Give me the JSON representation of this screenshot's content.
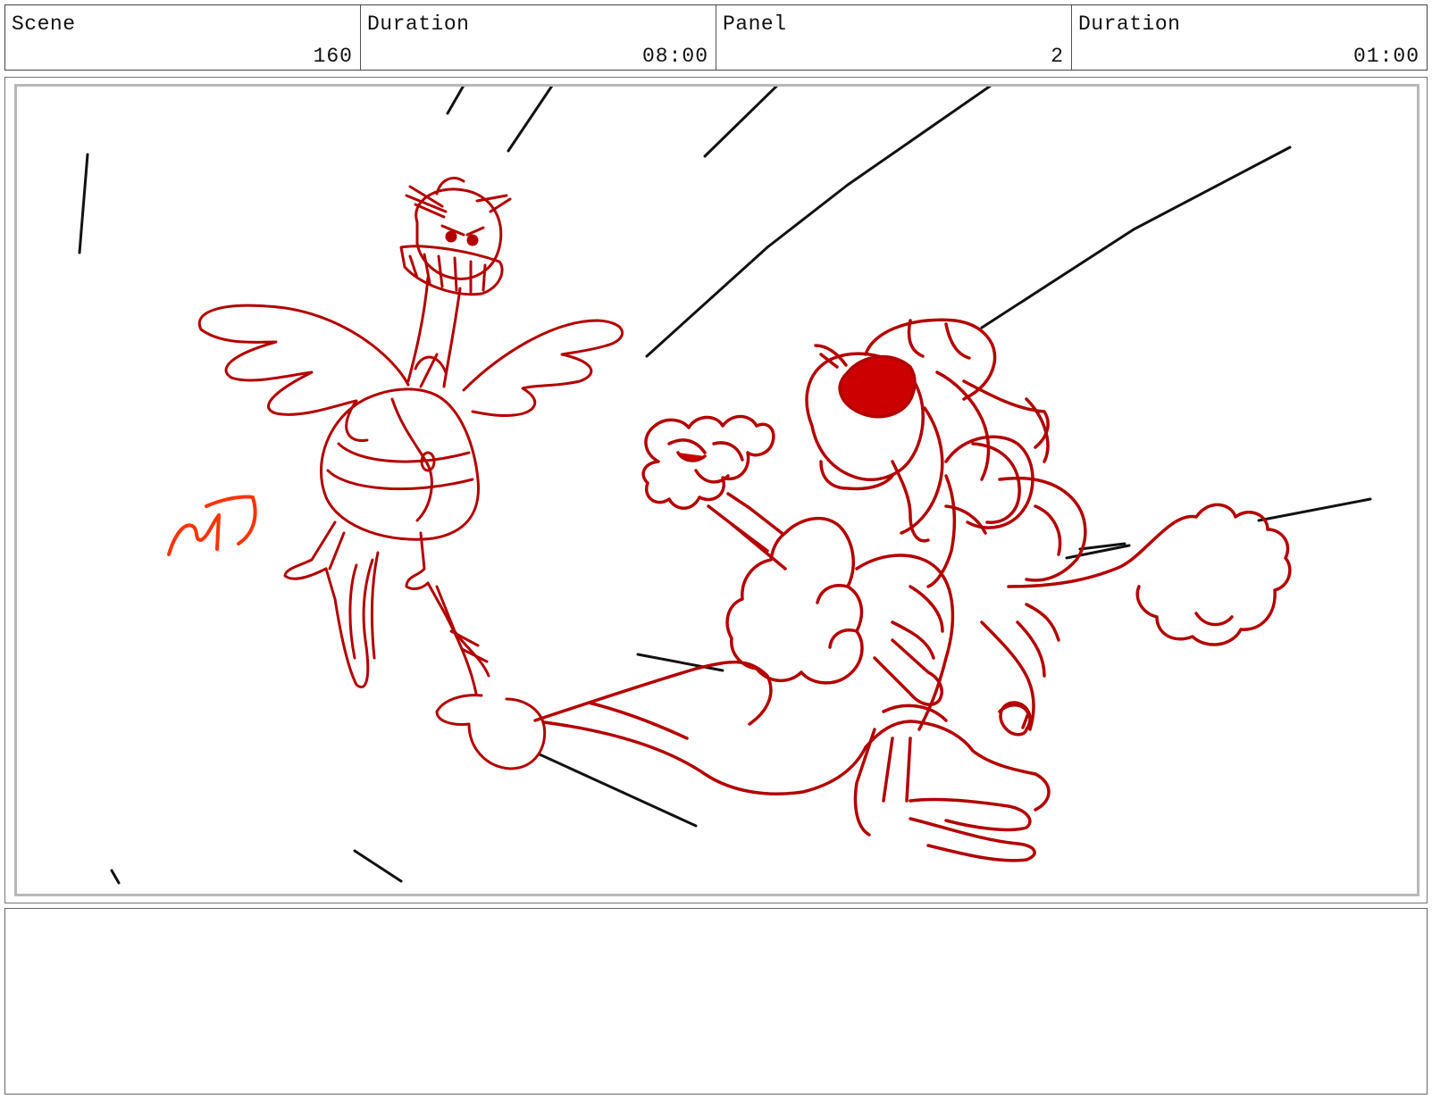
{
  "header": {
    "scene_label": "Scene",
    "scene_value": "160",
    "scene_duration_label": "Duration",
    "scene_duration_value": "08:00",
    "panel_label": "Panel",
    "panel_value": "2",
    "panel_duration_label": "Duration",
    "panel_duration_value": "01:00"
  },
  "panel": {
    "line_color": "#b30000",
    "speed_line_color": "#111111",
    "signature_color": "#ff3300",
    "sketch_icon": "storyboard-drawing"
  },
  "notes": {
    "text": ""
  }
}
